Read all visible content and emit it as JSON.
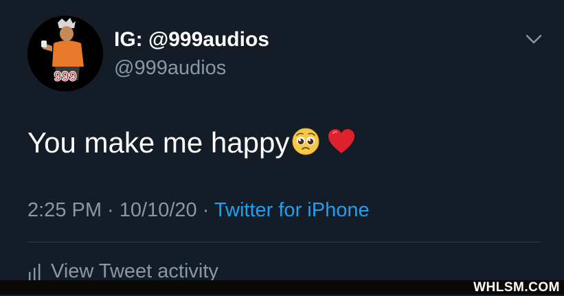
{
  "author": {
    "display_name": "IG: @999audios",
    "handle": "@999audios",
    "avatar_text": "999"
  },
  "tweet": {
    "text": "You make me happy",
    "emojis": [
      "pleading-face-icon",
      "red-heart-icon"
    ]
  },
  "meta": {
    "time": "2:25 PM",
    "separator_1": " · ",
    "date": "10/10/20",
    "separator_2": " · ",
    "source": "Twitter for iPhone"
  },
  "actions": {
    "activity_label": "View Tweet activity"
  },
  "watermark": "WHLSM.COM",
  "colors": {
    "background": "#141c28",
    "secondary_text": "#8899a6",
    "link": "#1da1f2",
    "divider": "#2f3b47"
  }
}
